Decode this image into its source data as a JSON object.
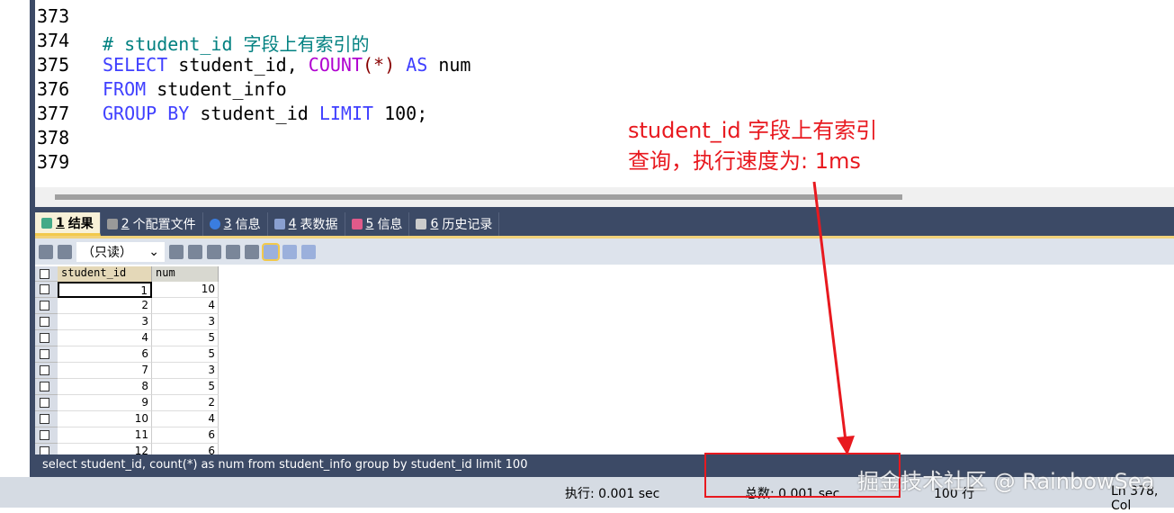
{
  "editor": {
    "lines": [
      {
        "n": "373",
        "html": ""
      },
      {
        "n": "374",
        "comment": "# student_id 字段上有索引的"
      },
      {
        "n": "375",
        "parts": [
          "SELECT",
          " student_id, ",
          "COUNT",
          "(*) ",
          "AS",
          " num"
        ]
      },
      {
        "n": "376",
        "parts": [
          "FROM",
          " student_info"
        ]
      },
      {
        "n": "377",
        "parts": [
          "GROUP BY",
          " student_id ",
          "LIMIT",
          " 100;"
        ]
      },
      {
        "n": "378"
      },
      {
        "n": "379"
      }
    ]
  },
  "tabs": [
    {
      "num": "1",
      "label": "结果"
    },
    {
      "num": "2",
      "label": "个配置文件"
    },
    {
      "num": "3",
      "label": "信息"
    },
    {
      "num": "4",
      "label": "表数据"
    },
    {
      "num": "5",
      "label": "信息"
    },
    {
      "num": "6",
      "label": "历史记录"
    }
  ],
  "toolbar": {
    "mode": "（只读）"
  },
  "grid": {
    "columns": [
      "student_id",
      "num"
    ],
    "rows": [
      [
        "1",
        "10"
      ],
      [
        "2",
        "4"
      ],
      [
        "3",
        "3"
      ],
      [
        "4",
        "5"
      ],
      [
        "6",
        "5"
      ],
      [
        "7",
        "3"
      ],
      [
        "8",
        "5"
      ],
      [
        "9",
        "2"
      ],
      [
        "10",
        "4"
      ],
      [
        "11",
        "6"
      ],
      [
        "12",
        "6"
      ]
    ]
  },
  "sql_bar": "select student_id, count(*) as num from student_info group by student_id limit 100",
  "status": {
    "exec": "执行: 0.001 sec",
    "total": "总数: 0.001 sec",
    "rows": "100 行",
    "pos": "Ln 378, Col"
  },
  "annotation": {
    "line1": "student_id 字段上有索引",
    "line2": "查询，执行速度为: 1ms"
  },
  "watermark": "掘金技术社区 @ RainbowSea"
}
